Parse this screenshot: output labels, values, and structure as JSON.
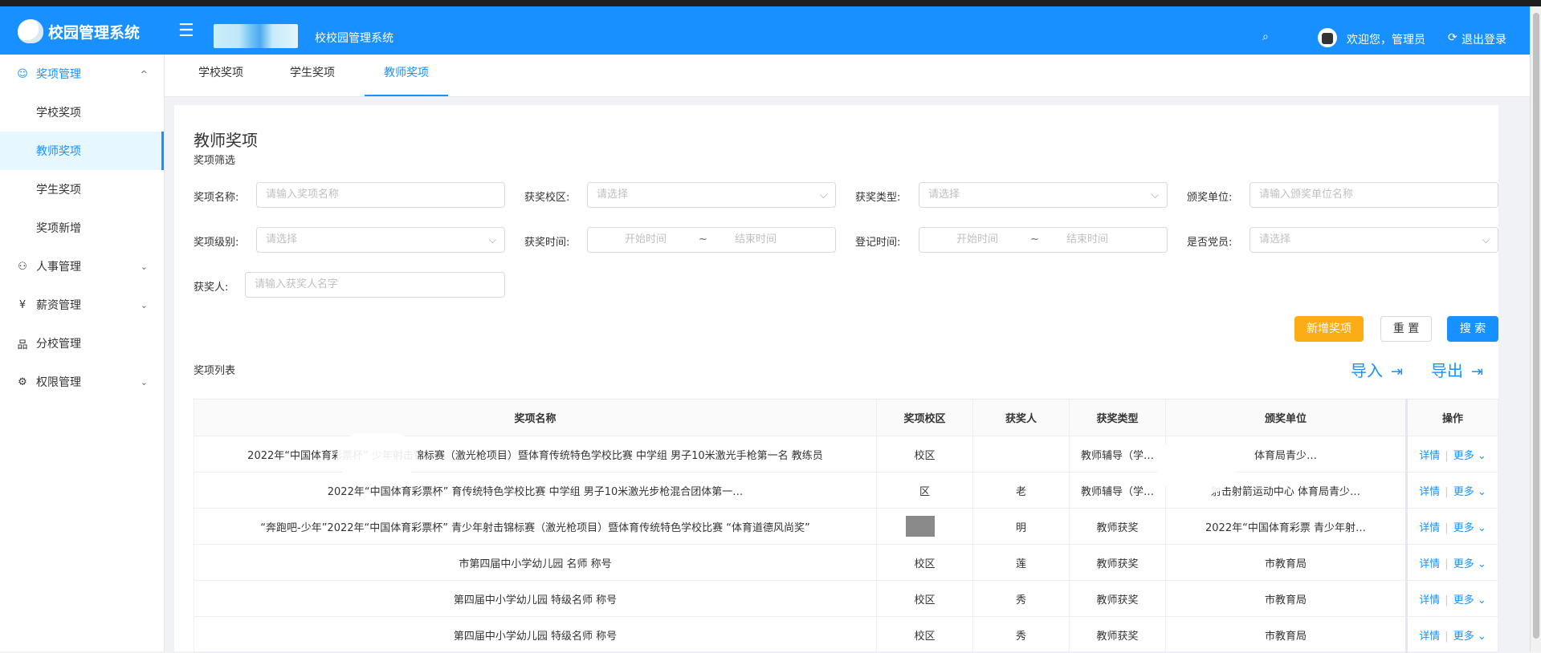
{
  "header": {
    "app_title": "校园管理系统",
    "system_name": "校校园管理系统",
    "menu_toggle_icon": "☰",
    "search_icon": "⌕",
    "welcome": "欢迎您，管理员",
    "logout_icon": "⟳",
    "logout": "退出登录"
  },
  "sidebar": {
    "items": [
      {
        "icon": "☺",
        "label": "奖项管理",
        "chevron": "^"
      },
      {
        "label": "学校奖项"
      },
      {
        "label": "教师奖项"
      },
      {
        "label": "学生奖项"
      },
      {
        "label": "奖项新增"
      },
      {
        "icon": "⚇",
        "label": "人事管理",
        "chevron": "⌄"
      },
      {
        "icon": "¥",
        "label": "薪资管理",
        "chevron": "⌄"
      },
      {
        "icon": "品",
        "label": "分校管理"
      },
      {
        "icon": "⚙",
        "label": "权限管理",
        "chevron": "⌄"
      }
    ]
  },
  "tabs": [
    "学校奖项",
    "学生奖项",
    "教师奖项"
  ],
  "page": {
    "title": "教师奖项",
    "subtitle": "奖项筛选",
    "list_title": "奖项列表"
  },
  "filters": {
    "award_name_label": "奖项名称:",
    "award_name_placeholder": "请输入奖项名称",
    "campus_label": "获奖校区:",
    "campus_placeholder": "请选择",
    "type_label": "获奖类型:",
    "type_placeholder": "请选择",
    "issuer_label": "颁奖单位:",
    "issuer_placeholder": "请输入颁奖单位名称",
    "level_label": "奖项级别:",
    "level_placeholder": "请选择",
    "award_time_label": "获奖时间:",
    "start_time": "开始时间",
    "range_sep": "~",
    "end_time": "结束时间",
    "reg_time_label": "登记时间:",
    "party_label": "是否党员:",
    "party_placeholder": "请选择",
    "winner_label": "获奖人:",
    "winner_placeholder": "请输入获奖人名字",
    "select_arrow": "⌵"
  },
  "buttons": {
    "add": "新增奖项",
    "reset": "重 置",
    "search": "搜 索",
    "import": "导入",
    "export": "导出",
    "io_icon": "⇥"
  },
  "table": {
    "columns": [
      "奖项名称",
      "奖项校区",
      "获奖人",
      "获奖类型",
      "颁奖单位",
      "操作"
    ],
    "rows": [
      {
        "name": "2022年“中国体育彩票杯” 少年射击锦标赛（激光枪项目）暨体育传统特色学校比赛 中学组 男子10米激光手枪第一名 教练员",
        "campus": "校区",
        "winner": "",
        "type": "教师辅导（学…",
        "issuer": "体育局青少…"
      },
      {
        "name": "2022年“中国体育彩票杯” 育传统特色学校比赛 中学组 男子10米激光步枪混合团体第一…",
        "campus": "区",
        "winner": "老",
        "type": "教师辅导（学…",
        "issuer": "射击射箭运动中心 体育局青少…"
      },
      {
        "name": "“奔跑吧-少年”2022年“中国体育彩票杯” 青少年射击锦标赛（激光枪项目）暨体育传统特色学校比赛 “体育道德风尚奖”",
        "campus": "区",
        "winner": "明",
        "type": "教师获奖",
        "issuer": "2022年“中国体育彩票 青少年射…"
      },
      {
        "name": "市第四届中小学幼儿园 名师 称号",
        "campus": "校区",
        "winner": "莲",
        "type": "教师获奖",
        "issuer": "市教育局"
      },
      {
        "name": "第四届中小学幼儿园 特级名师 称号",
        "campus": "校区",
        "winner": "秀",
        "type": "教师获奖",
        "issuer": "市教育局"
      },
      {
        "name": "第四届中小学幼儿园 特级名师 称号",
        "campus": "校区",
        "winner": "秀",
        "type": "教师获奖",
        "issuer": "市教育局"
      }
    ],
    "op_detail": "详情",
    "op_sep": "|",
    "op_more": "更多 ⌄"
  }
}
